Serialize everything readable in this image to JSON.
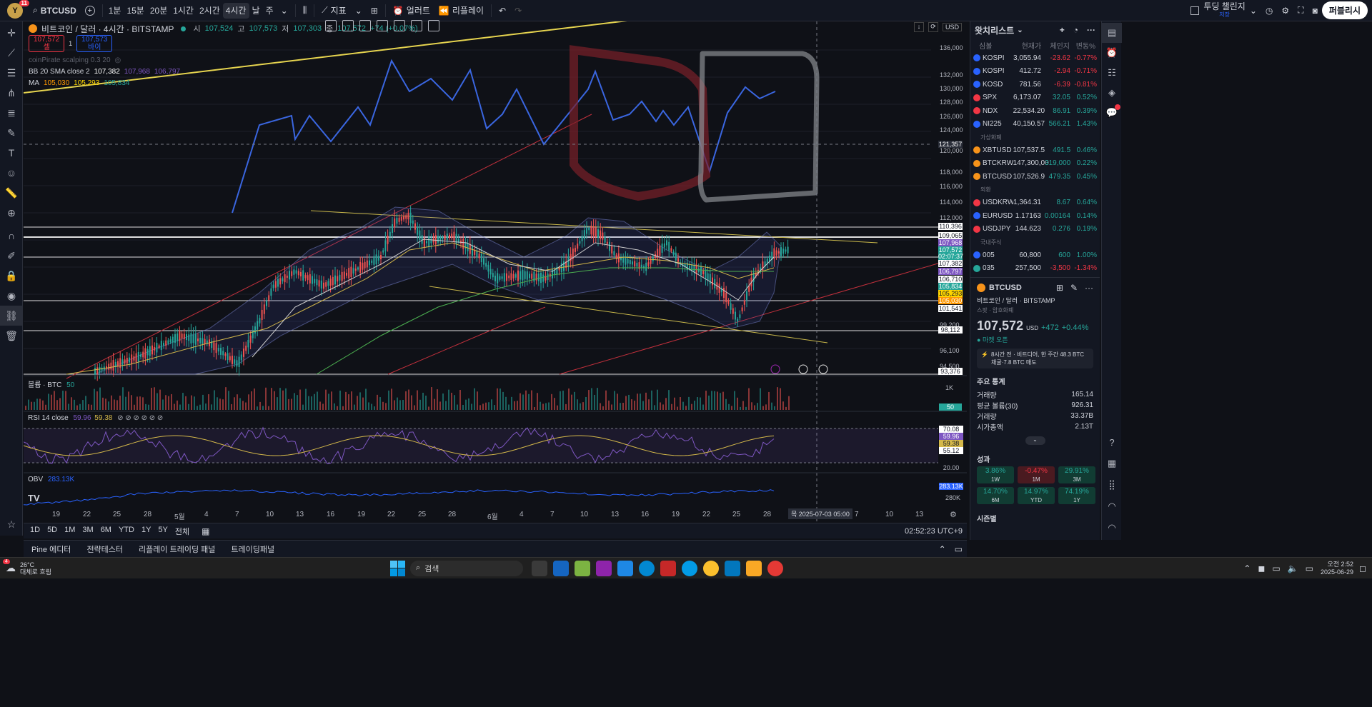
{
  "topbar": {
    "avatar_letter": "Y",
    "avatar_badge": "11",
    "symbol": "BTCUSD",
    "timeframes": [
      "1분",
      "15분",
      "20분",
      "1시간",
      "2시간",
      "4시간",
      "날",
      "주"
    ],
    "active_timeframe": "4시간",
    "indicators_label": "지표",
    "alert_label": "얼러트",
    "replay_label": "리플레이",
    "challenge_label": "투딩 챌린지",
    "challenge_sub": "저장",
    "publish_label": "퍼블리시"
  },
  "legend": {
    "title": "비트코인 / 달러 · 4시간 · BITSTAMP",
    "open_k": "시",
    "open_v": "107,524",
    "high_k": "고",
    "high_v": "107,573",
    "low_k": "저",
    "low_v": "107,303",
    "close_k": "종",
    "close_v": "107,572",
    "change": "+74 (+0.07%)",
    "sell_price": "107,572",
    "sell_label": "셀",
    "spread": "1",
    "buy_price": "107,573",
    "buy_label": "바이",
    "indicator1": "coinPirate scalping 0.3 20",
    "bb_label": "BB 20 SMA close 2",
    "bb_v1": "107,382",
    "bb_v2": "107,968",
    "bb_v3": "106,797",
    "ma_label": "MA",
    "ma_v1": "105,030",
    "ma_v2": "105,293",
    "ma_v3": "105,834",
    "currency": "USD"
  },
  "price_axis": {
    "ticks": [
      "136,000",
      "132,000",
      "130,000",
      "128,000",
      "126,000",
      "124,000",
      "122,000",
      "120,000",
      "118,000",
      "116,000",
      "114,000",
      "112,000",
      "99,200",
      "96,100",
      "94,500"
    ],
    "labels": [
      {
        "text": "121,357",
        "color": "#2a2e39"
      },
      {
        "text": "110,396",
        "color": "#ffffff"
      },
      {
        "text": "109,065",
        "color": "#ffffff"
      },
      {
        "text": "107,968",
        "color": "#7e57c2"
      },
      {
        "text": "107,572",
        "color": "#26a69a"
      },
      {
        "text": "02:07:37",
        "color": "#26a69a"
      },
      {
        "text": "107,382",
        "color": "#ffffff"
      },
      {
        "text": "106,797",
        "color": "#7e57c2"
      },
      {
        "text": "106,710",
        "color": "#ffffff"
      },
      {
        "text": "105,834",
        "color": "#26a69a"
      },
      {
        "text": "105,293",
        "color": "#ffd600"
      },
      {
        "text": "105,030",
        "color": "#ff9800"
      },
      {
        "text": "101,541",
        "color": "#ffffff"
      },
      {
        "text": "98,112",
        "color": "#ffffff"
      },
      {
        "text": "93,376",
        "color": "#ffffff"
      }
    ]
  },
  "volume": {
    "label": "볼륨 · BTC",
    "value": "50",
    "axis": "1K",
    "badge": "50"
  },
  "rsi": {
    "label": "RSI 14 close",
    "v1": "59.96",
    "v2": "59.38",
    "levels": [
      "70.08",
      "59.96",
      "59.38",
      "55.12",
      "20.00"
    ]
  },
  "obv": {
    "label": "OBV",
    "value": "283.13K",
    "badge": "283.13K",
    "axis": "280K"
  },
  "time_axis": {
    "ticks": [
      "19",
      "22",
      "25",
      "28",
      "5월",
      "4",
      "7",
      "10",
      "13",
      "16",
      "19",
      "22",
      "25",
      "28",
      "6월",
      "4",
      "7",
      "10",
      "13",
      "16",
      "19",
      "22",
      "25",
      "28",
      "7",
      "10",
      "13"
    ],
    "cursor_label": "목 2025-07-03 05:00"
  },
  "bottom": {
    "ranges": [
      "1D",
      "5D",
      "1M",
      "3M",
      "6M",
      "YTD",
      "1Y",
      "5Y",
      "전체"
    ],
    "clock": "02:52:23 UTC+9"
  },
  "panel_tabs": [
    "Pine 에디터",
    "전략테스터",
    "리플레이 트레이딩 패널",
    "트레이딩패널"
  ],
  "watchlist": {
    "title": "왓치리스트",
    "cols": [
      "심볼",
      "현재가",
      "체인지",
      "변동%"
    ],
    "groups": [
      {
        "section": "",
        "rows": [
          {
            "sym": "KOSPI",
            "last": "3,055.94",
            "chg": "-23.62",
            "pct": "-0.77%",
            "dir": "neg",
            "color": "#2962ff"
          },
          {
            "sym": "KOSPI",
            "last": "412.72",
            "chg": "-2.94",
            "pct": "-0.71%",
            "dir": "neg",
            "color": "#2962ff"
          },
          {
            "sym": "KOSD",
            "last": "781.56",
            "chg": "-6.39",
            "pct": "-0.81%",
            "dir": "neg",
            "color": "#2962ff"
          },
          {
            "sym": "SPX",
            "last": "6,173.07",
            "chg": "32.05",
            "pct": "0.52%",
            "dir": "pos",
            "color": "#f23645"
          },
          {
            "sym": "NDX",
            "last": "22,534.20",
            "chg": "86.91",
            "pct": "0.39%",
            "dir": "pos",
            "color": "#f23645"
          },
          {
            "sym": "NI225",
            "last": "40,150.57",
            "chg": "566.21",
            "pct": "1.43%",
            "dir": "pos",
            "color": "#2962ff"
          }
        ]
      },
      {
        "section": "가상화폐",
        "rows": [
          {
            "sym": "XBTUSD",
            "last": "107,537.5",
            "chg": "491.5",
            "pct": "0.46%",
            "dir": "pos",
            "color": "#f7931a"
          },
          {
            "sym": "BTCKRW",
            "last": "147,300,00",
            "chg": "319,000",
            "pct": "0.22%",
            "dir": "pos",
            "color": "#f7931a"
          },
          {
            "sym": "BTCUSD",
            "last": "107,526.9",
            "chg": "479.35",
            "pct": "0.45%",
            "dir": "pos",
            "color": "#f7931a"
          }
        ]
      },
      {
        "section": "외환",
        "rows": [
          {
            "sym": "USDKRW",
            "last": "1,364.31",
            "chg": "8.67",
            "pct": "0.64%",
            "dir": "pos",
            "color": "#f23645"
          },
          {
            "sym": "EURUSD",
            "last": "1.17163",
            "chg": "0.00164",
            "pct": "0.14%",
            "dir": "pos",
            "color": "#2962ff"
          },
          {
            "sym": "USDJPY",
            "last": "144.623",
            "chg": "0.276",
            "pct": "0.19%",
            "dir": "pos",
            "color": "#f23645"
          }
        ]
      },
      {
        "section": "국내주식",
        "rows": [
          {
            "sym": "005",
            "last": "60,800",
            "chg": "600",
            "pct": "1.00%",
            "dir": "pos",
            "color": "#2962ff"
          },
          {
            "sym": "035",
            "last": "257,500",
            "chg": "-3,500",
            "pct": "-1.34%",
            "dir": "neg",
            "color": "#26a69a"
          }
        ]
      }
    ]
  },
  "details": {
    "symbol": "BTCUSD",
    "name": "비트코인 / 달러",
    "exchange": "BITSTAMP",
    "type": "스팟 · 암호화폐",
    "price": "107,572",
    "currency": "USD",
    "change": "+472",
    "change_pct": "+0.44%",
    "market": "마켓 오픈",
    "news": "8시간 전 · 비트디어, 한 주간 48.3 BTC 채굴·7.8 BTC 매도",
    "stats_title": "주요 통계",
    "stats": [
      {
        "k": "거래량",
        "v": "165.14"
      },
      {
        "k": "평균 볼륨(30)",
        "v": "926.31"
      },
      {
        "k": "거래량",
        "v": "33.37B"
      },
      {
        "k": "시가총액",
        "v": "2.13T"
      }
    ],
    "perf_title": "성과",
    "perf": [
      {
        "v": "3.86%",
        "p": "1W",
        "dir": "pos"
      },
      {
        "v": "-0.47%",
        "p": "1M",
        "dir": "neg"
      },
      {
        "v": "29.91%",
        "p": "3M",
        "dir": "pos"
      },
      {
        "v": "14.70%",
        "p": "6M",
        "dir": "pos"
      },
      {
        "v": "14.97%",
        "p": "YTD",
        "dir": "pos"
      },
      {
        "v": "74.19%",
        "p": "1Y",
        "dir": "pos"
      }
    ],
    "season_title": "시즌별"
  },
  "taskbar": {
    "weather_temp": "26°C",
    "weather_desc": "대체로 흐림",
    "weather_badge": "4",
    "search": "검색",
    "time": "오전 2:52",
    "date": "2025-06-29"
  }
}
